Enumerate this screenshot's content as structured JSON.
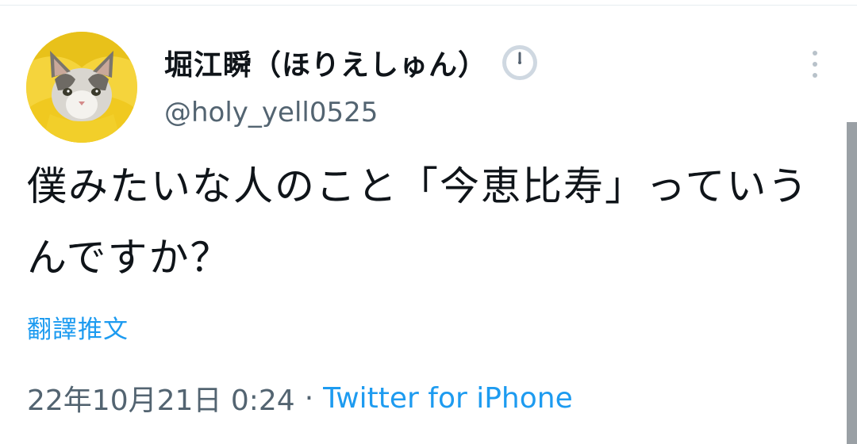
{
  "tweet": {
    "display_name": "堀江瞬（ほりえしゅん）",
    "status_emoji": "clock-icon",
    "handle": "@holy_yell0525",
    "text": "僕みたいな人のこと「今恵比寿」っていうんですか？",
    "translate_label": "翻譯推文",
    "date": "22年10月21日 0:24",
    "separator": "·",
    "source": "Twitter for iPhone",
    "more_icon": "more-vertical-icon",
    "colors": {
      "link": "#1d9bf0",
      "secondary": "#536471",
      "primary": "#0f1419",
      "avatar_background": "#f3d23a"
    }
  }
}
